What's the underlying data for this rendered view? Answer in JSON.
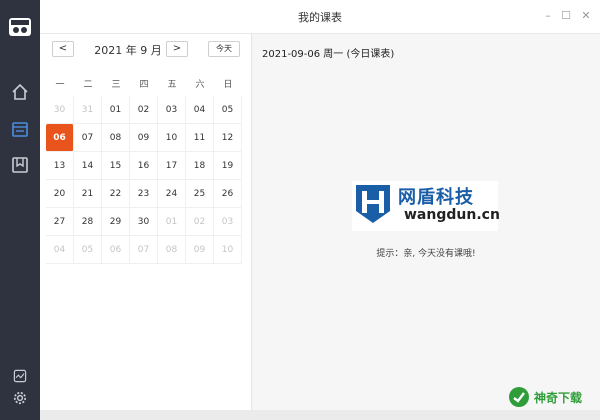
{
  "window": {
    "title": "我的课表",
    "controls": [
      "minimize-icon",
      "maximize-icon",
      "close-icon"
    ]
  },
  "sidebar": {
    "items": [
      {
        "name": "home-icon",
        "active": false
      },
      {
        "name": "schedule-icon",
        "active": true
      },
      {
        "name": "bookmark-icon",
        "active": false
      }
    ],
    "bottom": [
      {
        "name": "activity-icon"
      },
      {
        "name": "gear-icon"
      }
    ],
    "accent_color": "#4a8fe0"
  },
  "calendar": {
    "prev_label": "<",
    "next_label": ">",
    "month_label": "2021 年 9 月",
    "today_label": "今天",
    "weekdays": [
      "一",
      "二",
      "三",
      "四",
      "五",
      "六",
      "日"
    ],
    "weeks": [
      [
        {
          "d": "30",
          "other": true
        },
        {
          "d": "31",
          "other": true
        },
        {
          "d": "01"
        },
        {
          "d": "02"
        },
        {
          "d": "03"
        },
        {
          "d": "04"
        },
        {
          "d": "05"
        }
      ],
      [
        {
          "d": "06",
          "selected": true
        },
        {
          "d": "07"
        },
        {
          "d": "08"
        },
        {
          "d": "09"
        },
        {
          "d": "10"
        },
        {
          "d": "11"
        },
        {
          "d": "12"
        }
      ],
      [
        {
          "d": "13"
        },
        {
          "d": "14"
        },
        {
          "d": "15"
        },
        {
          "d": "16"
        },
        {
          "d": "17"
        },
        {
          "d": "18"
        },
        {
          "d": "19"
        }
      ],
      [
        {
          "d": "20"
        },
        {
          "d": "21"
        },
        {
          "d": "22"
        },
        {
          "d": "23"
        },
        {
          "d": "24"
        },
        {
          "d": "25"
        },
        {
          "d": "26"
        }
      ],
      [
        {
          "d": "27"
        },
        {
          "d": "28"
        },
        {
          "d": "29"
        },
        {
          "d": "30"
        },
        {
          "d": "01",
          "other": true
        },
        {
          "d": "02",
          "other": true
        },
        {
          "d": "03",
          "other": true
        }
      ],
      [
        {
          "d": "04",
          "other": true
        },
        {
          "d": "05",
          "other": true
        },
        {
          "d": "06",
          "other": true
        },
        {
          "d": "07",
          "other": true
        },
        {
          "d": "08",
          "other": true
        },
        {
          "d": "09",
          "other": true
        },
        {
          "d": "10",
          "other": true
        }
      ]
    ],
    "selected_color": "#e8541c"
  },
  "main": {
    "date_heading": "2021-09-06 周一 (今日课表)",
    "logo_cn": "网盾科技",
    "logo_en": "wangdun.cn",
    "empty_hint": "提示：亲, 今天没有课哦!"
  },
  "watermark": {
    "text": "神奇下载"
  }
}
